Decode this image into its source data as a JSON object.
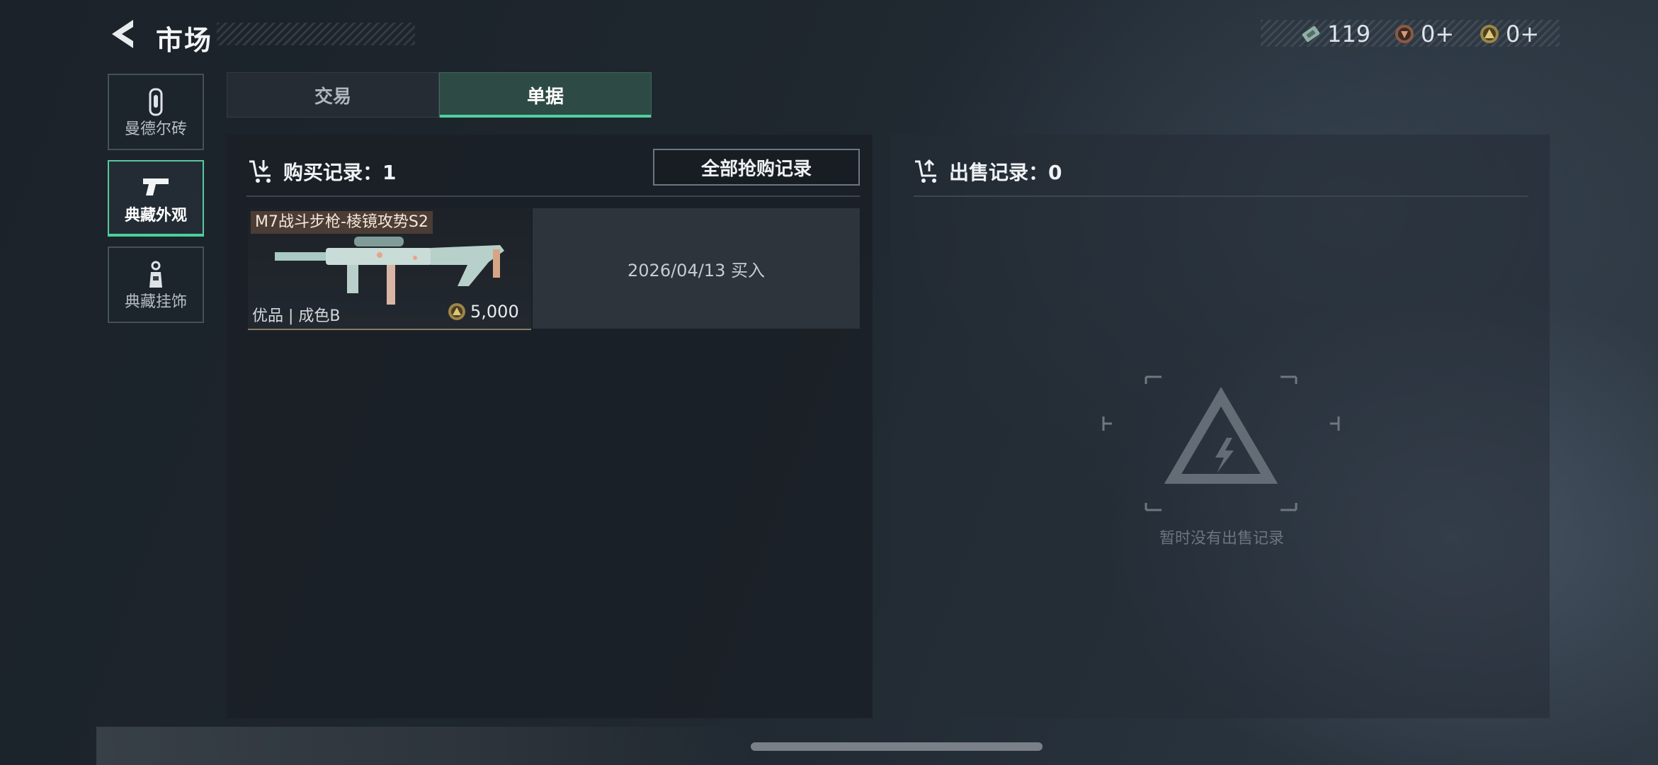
{
  "header": {
    "title": "市场"
  },
  "currencies": [
    {
      "name": "ticket-currency",
      "icon": "ticket-icon",
      "value": "119",
      "color": "#8fb0a8"
    },
    {
      "name": "bronze-currency",
      "icon": "bronze-coin-icon",
      "value": "0+",
      "color": "#a5705a"
    },
    {
      "name": "gold-currency",
      "icon": "gold-coin-icon",
      "value": "0+",
      "color": "#b59a55"
    }
  ],
  "sidebar": {
    "items": [
      {
        "label": "曼德尔砖",
        "icon": "brick-icon",
        "active": false
      },
      {
        "label": "典藏外观",
        "icon": "pistol-icon",
        "active": true
      },
      {
        "label": "典藏挂饰",
        "icon": "charm-icon",
        "active": false
      }
    ]
  },
  "tabs": [
    {
      "label": "交易",
      "active": false
    },
    {
      "label": "单据",
      "active": true
    }
  ],
  "buy_panel": {
    "title": "购买记录：1",
    "all_records_button": "全部抢购记录",
    "records": [
      {
        "item_name": "M7战斗步枪-棱镜攻势S2",
        "grade": "优品 | 成色B",
        "price": "5,000",
        "date_text": "2026/04/13 买入"
      }
    ]
  },
  "sell_panel": {
    "title": "出售记录：0",
    "empty_text": "暂时没有出售记录"
  },
  "colors": {
    "accent": "#49d19a",
    "active_tab": "#2e4a44"
  }
}
